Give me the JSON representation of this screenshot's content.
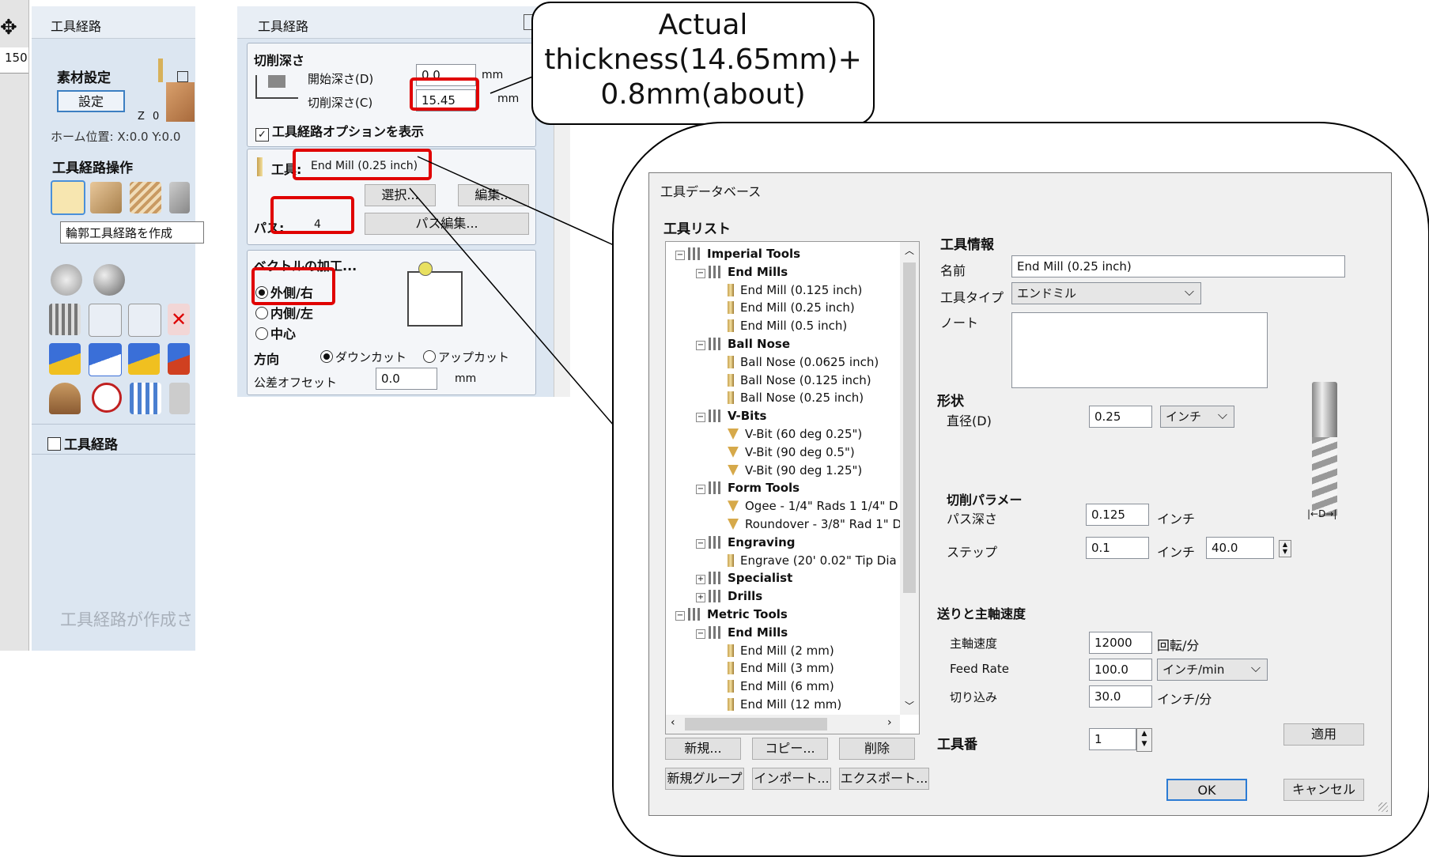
{
  "left_panel": {
    "header_title": "工具経路",
    "ruler_value": "150",
    "stock_heading": "素材設定",
    "setup_button": "設定",
    "z_label": "Z 0",
    "home_position": "ホーム位置:  X:0.0 Y:0.0",
    "operations_heading": "工具経路操作",
    "tooltip": "輪郭工具経路を作成",
    "toolpaths_heading": "工具経路",
    "empty_message": "工具経路が作成さ"
  },
  "toolpath_panel": {
    "header_title": "工具経路",
    "cut_depth_heading": "切削深さ",
    "start_depth_label": "開始深さ(D)",
    "start_depth_value": "0.0",
    "start_depth_unit": "mm",
    "cut_depth_label": "切削深さ(C)",
    "cut_depth_value": "15.45",
    "cut_depth_unit": "mm",
    "show_options_label": "工具経路オプションを表示",
    "tool_label": "工具:",
    "tool_value": "End Mill (0.25 inch)",
    "select_button": "選択...",
    "edit_button": "編集...",
    "passes_label": "パス:",
    "passes_value": "4",
    "edit_passes_button": "パス編集...",
    "machine_vectors_heading": "ベクトルの加工...",
    "outside_right": "外側/右",
    "inside_left": "内側/左",
    "center": "中心",
    "direction_label": "方向",
    "climb": "ダウンカット",
    "conventional": "アップカット",
    "allowance_label": "公差オフセット",
    "allowance_value": "0.0",
    "allowance_unit": "mm"
  },
  "callout": {
    "line1": "Actual",
    "line2": "thickness(14.65mm)+",
    "line3": "0.8mm(about)"
  },
  "tool_database": {
    "title": "工具データベース",
    "tool_list_heading": "工具リスト",
    "tree": [
      {
        "label": "Imperial Tools",
        "level": 0,
        "kind": "group",
        "expanded": true
      },
      {
        "label": "End Mills",
        "level": 1,
        "kind": "group",
        "expanded": true
      },
      {
        "label": "End Mill (0.125 inch)",
        "level": 2,
        "kind": "bit"
      },
      {
        "label": "End Mill (0.25 inch)",
        "level": 2,
        "kind": "bit"
      },
      {
        "label": "End Mill (0.5 inch)",
        "level": 2,
        "kind": "bit"
      },
      {
        "label": "Ball Nose",
        "level": 1,
        "kind": "group",
        "expanded": true
      },
      {
        "label": "Ball Nose (0.0625 inch)",
        "level": 2,
        "kind": "bit"
      },
      {
        "label": "Ball Nose (0.125 inch)",
        "level": 2,
        "kind": "bit"
      },
      {
        "label": "Ball Nose (0.25 inch)",
        "level": 2,
        "kind": "bit"
      },
      {
        "label": "V-Bits",
        "level": 1,
        "kind": "group",
        "expanded": true
      },
      {
        "label": "V-Bit (60 deg 0.25\")",
        "level": 2,
        "kind": "vbit"
      },
      {
        "label": "V-Bit (90 deg 0.5\")",
        "level": 2,
        "kind": "vbit"
      },
      {
        "label": "V-Bit (90 deg 1.25\")",
        "level": 2,
        "kind": "vbit"
      },
      {
        "label": "Form Tools",
        "level": 1,
        "kind": "group",
        "expanded": true
      },
      {
        "label": "Ogee - 1/4\" Rads 1 1/4\" D",
        "level": 2,
        "kind": "vbit"
      },
      {
        "label": "Roundover - 3/8\" Rad 1\" D",
        "level": 2,
        "kind": "vbit"
      },
      {
        "label": "Engraving",
        "level": 1,
        "kind": "group",
        "expanded": true
      },
      {
        "label": "Engrave (20' 0.02\" Tip Dia",
        "level": 2,
        "kind": "bit"
      },
      {
        "label": "Specialist",
        "level": 1,
        "kind": "group",
        "expanded": false
      },
      {
        "label": "Drills",
        "level": 1,
        "kind": "group",
        "expanded": false
      },
      {
        "label": "Metric Tools",
        "level": 0,
        "kind": "group",
        "expanded": true
      },
      {
        "label": "End Mills",
        "level": 1,
        "kind": "group",
        "expanded": true
      },
      {
        "label": "End Mill (2 mm)",
        "level": 2,
        "kind": "bit"
      },
      {
        "label": "End Mill (3 mm)",
        "level": 2,
        "kind": "bit"
      },
      {
        "label": "End Mill (6 mm)",
        "level": 2,
        "kind": "bit"
      },
      {
        "label": "End Mill (12 mm)",
        "level": 2,
        "kind": "bit"
      }
    ],
    "new_button": "新規...",
    "copy_button": "コピー...",
    "delete_button": "削除",
    "new_group_button": "新規グループ",
    "import_button": "インポート...",
    "export_button": "エクスポート...",
    "info_heading": "工具情報",
    "name_label": "名前",
    "name_value": "End Mill (0.25 inch)",
    "tool_type_label": "工具タイプ",
    "tool_type_value": "エンドミル",
    "notes_label": "ノート",
    "geometry_heading": "形状",
    "diameter_label": "直径(D)",
    "diameter_value": "0.25",
    "diameter_unit": "インチ",
    "cut_params_heading": "切削パラメー",
    "pass_depth_label": "パス深さ",
    "pass_depth_value": "0.125",
    "pass_depth_unit": "インチ",
    "stepover_label": "ステップ",
    "stepover_value": "0.1",
    "stepover_unit": "インチ",
    "stepover_percent": "40.0",
    "feeds_heading": "送りと主軸速度",
    "spindle_label": "主軸速度",
    "spindle_value": "12000",
    "spindle_unit": "回転/分",
    "feed_label": "Feed Rate",
    "feed_value": "100.0",
    "feed_unit": "インチ/min",
    "plunge_label": "切り込み",
    "plunge_value": "30.0",
    "plunge_unit": "インチ/分",
    "tool_number_label": "工具番",
    "tool_number_value": "1",
    "apply_button": "適用",
    "ok_button": "OK",
    "cancel_button": "キャンセル",
    "diagram_label": "D"
  }
}
